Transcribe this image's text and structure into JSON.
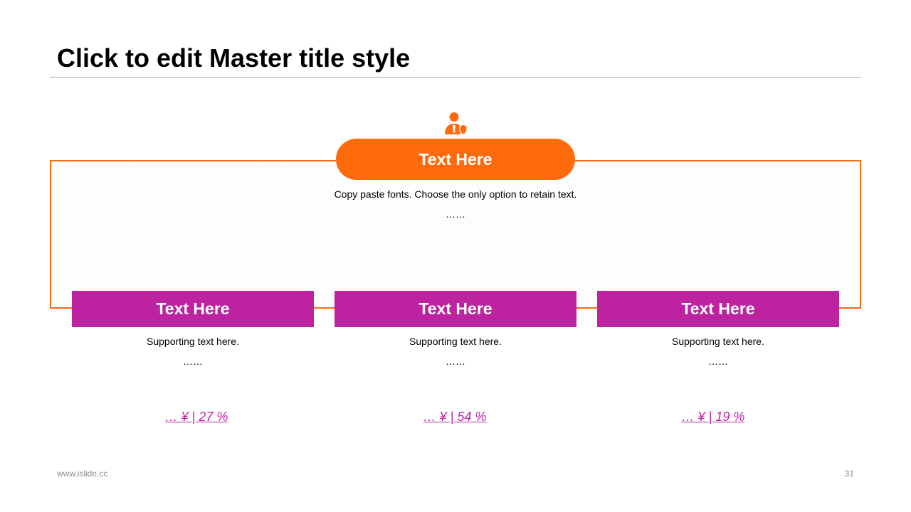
{
  "slide": {
    "title": "Click to edit Master title style"
  },
  "center": {
    "icon": "user-shield-icon",
    "heading": "Text Here",
    "description": "Copy paste fonts. Choose the only option to retain text.",
    "ellipsis": "……"
  },
  "cards": [
    {
      "heading": "Text Here",
      "text": "Supporting text here.",
      "ellipsis": "……",
      "stat": "…  ¥ | 27 %"
    },
    {
      "heading": "Text Here",
      "text": "Supporting text here.",
      "ellipsis": "……",
      "stat": "…  ¥ | 54 %"
    },
    {
      "heading": "Text Here",
      "text": "Supporting text here.",
      "ellipsis": "……",
      "stat": "…  ¥ | 19 %"
    }
  ],
  "footer": {
    "url": "www.islide.cc",
    "page_number": "31"
  },
  "colors": {
    "accent_orange": "#ff6a0d",
    "accent_magenta": "#bd22a1",
    "rule_gray": "#a6a6a6",
    "footer_gray": "#8c8c8c"
  }
}
